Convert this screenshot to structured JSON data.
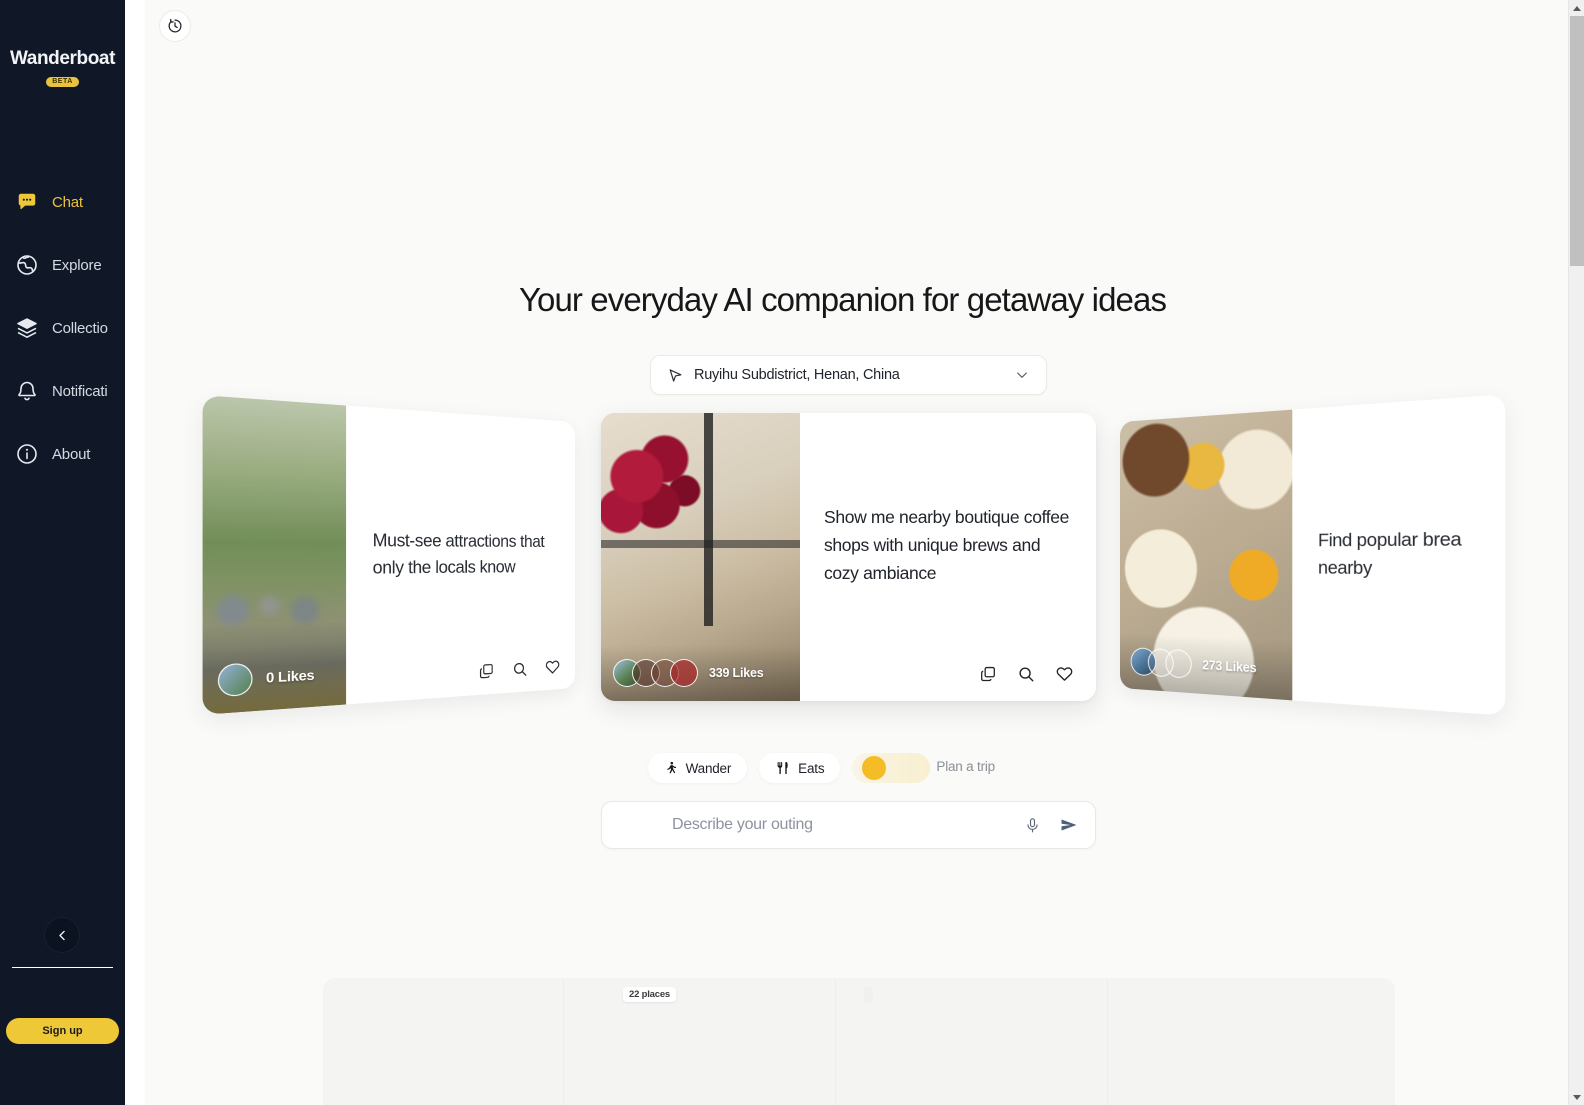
{
  "brand": {
    "name": "Wanderboat",
    "badge": "BETA"
  },
  "sidebar": {
    "items": [
      {
        "label": "Chat",
        "icon": "chat-bubble-icon",
        "active": true
      },
      {
        "label": "Explore",
        "icon": "globe-icon",
        "active": false
      },
      {
        "label": "Collectio",
        "icon": "layers-icon",
        "active": false
      },
      {
        "label": "Notificati",
        "icon": "bell-icon",
        "active": false
      },
      {
        "label": "About",
        "icon": "info-icon",
        "active": false
      }
    ],
    "collapse_icon": "chevron-left-icon",
    "signup_label": "Sign up",
    "accent_color": "#EFC838",
    "background_color": "#101828"
  },
  "topbar": {
    "history_icon": "clock-rewind-icon"
  },
  "hero": {
    "headline": "Your everyday AI companion for getaway ideas",
    "location": {
      "value": "Ruyihu Subdistrict, Henan, China",
      "pin_icon": "navigation-arrow-icon",
      "chevron_icon": "chevron-down-icon"
    }
  },
  "cards": [
    {
      "prompt": "Must-see attractions that only the locals know",
      "likes": "0 Likes",
      "avatars": 1,
      "actions": [
        "copy-icon",
        "search-icon",
        "heart-icon"
      ],
      "photo": "park-crowd-sunset"
    },
    {
      "prompt": "Show me nearby boutique coffee shops with unique brews and cozy ambiance",
      "likes": "339 Likes",
      "avatars": 4,
      "actions": [
        "copy-icon",
        "search-icon",
        "heart-icon"
      ],
      "photo": "roses-cafe-window"
    },
    {
      "prompt": "Find popular brea nearby",
      "likes": "273 Likes",
      "avatars": 3,
      "actions": [
        "copy-icon",
        "search-icon",
        "heart-icon"
      ],
      "photo": "brunch-table"
    }
  ],
  "modes": [
    {
      "label": "Wander",
      "icon": "walking-person-icon",
      "state": "idle"
    },
    {
      "label": "Eats",
      "icon": "fork-knife-icon",
      "state": "idle"
    },
    {
      "label": "Plan a trip",
      "icon": "loading-spinner-icon",
      "state": "loading"
    }
  ],
  "composer": {
    "placeholder": "Describe your outing",
    "mic_icon": "microphone-icon",
    "send_icon": "send-paper-plane-icon"
  },
  "results_skeleton": {
    "badge": "22 places"
  },
  "scrollbar": {
    "up_icon": "scroll-up-arrow",
    "down_icon": "scroll-down-arrow"
  }
}
